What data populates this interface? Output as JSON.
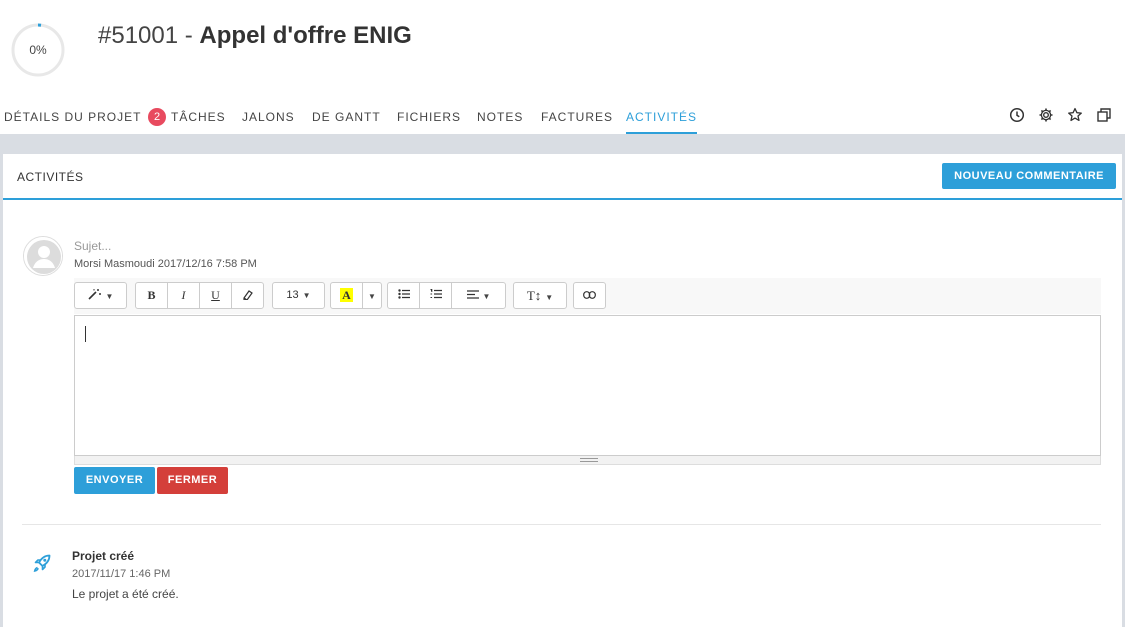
{
  "header": {
    "progress": {
      "label": "0%",
      "value": 0.02
    },
    "project_number": "#51001",
    "title_separator": " - ",
    "project_name": "Appel d'offre ENIG"
  },
  "tabs": [
    {
      "label": "DÉTAILS DU PROJET",
      "active": false
    },
    {
      "label": "TÂCHES",
      "badge": "2",
      "active": false
    },
    {
      "label": "JALONS",
      "active": false
    },
    {
      "label": "DE GANTT",
      "active": false
    },
    {
      "label": "FICHIERS",
      "active": false
    },
    {
      "label": "NOTES",
      "active": false
    },
    {
      "label": "FACTURES",
      "active": false
    },
    {
      "label": "ACTIVITÉS",
      "active": true
    }
  ],
  "tab_tools": [
    "clock-icon",
    "gear-icon",
    "star-icon",
    "copy-icon"
  ],
  "panel": {
    "title": "ACTIVITÉS",
    "new_comment_label": "NOUVEAU COMMENTAIRE"
  },
  "comment_form": {
    "subject_placeholder": "Sujet...",
    "author": "Morsi Masmoudi",
    "date": "2017/12/16 7:58 PM",
    "toolbar": {
      "font_size": "13",
      "groups": [
        "magic-wand-icon",
        "bold",
        "italic",
        "underline",
        "eraser-icon",
        "font-size",
        "color-highlight",
        "unordered-list",
        "ordered-list",
        "align",
        "text-height",
        "link-icon"
      ]
    },
    "send_label": "ENVOYER",
    "close_label": "FERMER"
  },
  "activities": [
    {
      "icon": "rocket-icon",
      "title": "Projet créé",
      "date": "2017/11/17 1:46 PM",
      "text": "Le projet a été créé."
    }
  ],
  "colors": {
    "accent": "#2d9fd9",
    "danger": "#d43f3a",
    "badge": "#e84a5f",
    "band": "#d9dde3"
  }
}
